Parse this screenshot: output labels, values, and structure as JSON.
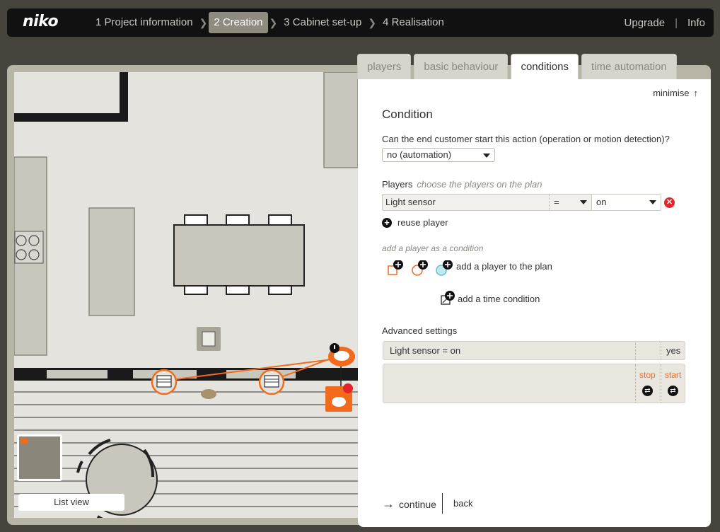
{
  "topbar": {
    "logo": "niko",
    "steps": [
      "1 Project information",
      "2 Creation",
      "3 Cabinet set-up",
      "4 Realisation"
    ],
    "active_step": 1,
    "upgrade": "Upgrade",
    "info": "Info",
    "separator": "|"
  },
  "plan": {
    "list_view_label": "List view"
  },
  "panel": {
    "tabs": [
      "players",
      "basic behaviour",
      "conditions",
      "time automation"
    ],
    "active_tab": 2,
    "minimise_label": "minimise",
    "title": "Condition",
    "question": "Can the end customer start this action (operation or motion detection)?",
    "start_select_value": "no (automation)",
    "players_label": "Players",
    "players_hint": "choose the players on the plan",
    "player_row": {
      "name": "Light sensor",
      "operator": "=",
      "value": "on"
    },
    "reuse_label": "reuse player",
    "add_condition_label": "add a player as a condition",
    "add_plan_label": "add a player to the plan",
    "add_time_label": "add a time condition",
    "advanced_label": "Advanced settings",
    "advanced_row": {
      "text": "Light sensor = on",
      "value": "yes"
    },
    "stop_label": "stop",
    "start_label": "start",
    "continue_label": "continue",
    "back_label": "back"
  },
  "colors": {
    "accent": "#f26b1d",
    "danger": "#e3242b",
    "topbar": "#111111",
    "background": "#46443d"
  }
}
